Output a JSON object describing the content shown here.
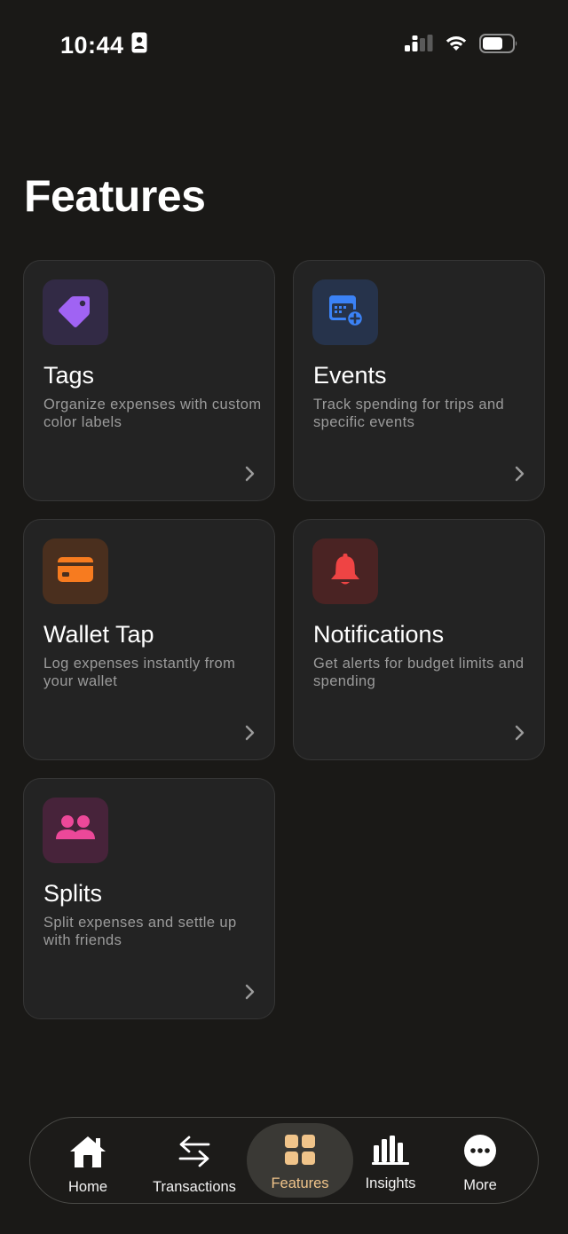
{
  "status_bar": {
    "time": "10:44"
  },
  "page": {
    "title": "Features"
  },
  "features": [
    {
      "title": "Tags",
      "description": "Organize expenses with custom color labels",
      "icon": "tag-icon",
      "accent": "#a063f3",
      "icon_bg": "#322a45"
    },
    {
      "title": "Events",
      "description": "Track spending for trips and specific events",
      "icon": "calendar-plus-icon",
      "accent": "#3b82f6",
      "icon_bg": "#26334b"
    },
    {
      "title": "Wallet Tap",
      "description": "Log expenses instantly from your wallet",
      "icon": "credit-card-icon",
      "accent": "#f77b1f",
      "icon_bg": "#4a2f1e"
    },
    {
      "title": "Notifications",
      "description": "Get alerts for budget limits and spending",
      "icon": "bell-icon",
      "accent": "#ef4444",
      "icon_bg": "#4a2323"
    },
    {
      "title": "Splits",
      "description": "Split expenses and settle up with friends",
      "icon": "users-icon",
      "accent": "#ec4899",
      "icon_bg": "#47233a"
    }
  ],
  "tab_bar": {
    "active": "Features",
    "active_color": "#f0c48a",
    "tabs": [
      {
        "label": "Home",
        "icon": "home-icon"
      },
      {
        "label": "Transactions",
        "icon": "arrows-exchange-icon"
      },
      {
        "label": "Features",
        "icon": "grid-icon"
      },
      {
        "label": "Insights",
        "icon": "bar-chart-icon"
      },
      {
        "label": "More",
        "icon": "more-dots-icon"
      }
    ]
  }
}
